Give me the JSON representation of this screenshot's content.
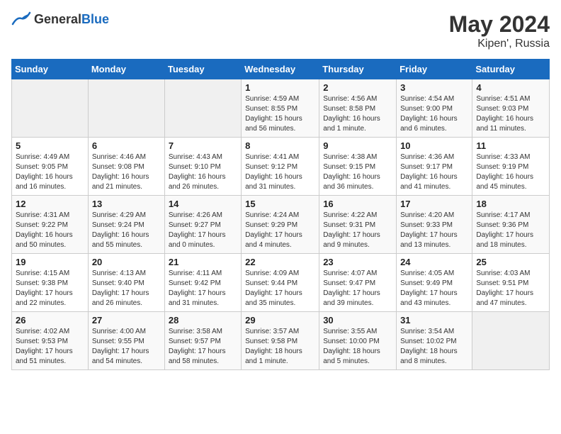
{
  "logo": {
    "general": "General",
    "blue": "Blue"
  },
  "title": {
    "month_year": "May 2024",
    "location": "Kipen', Russia"
  },
  "headers": [
    "Sunday",
    "Monday",
    "Tuesday",
    "Wednesday",
    "Thursday",
    "Friday",
    "Saturday"
  ],
  "weeks": [
    [
      {
        "day": "",
        "info": ""
      },
      {
        "day": "",
        "info": ""
      },
      {
        "day": "",
        "info": ""
      },
      {
        "day": "1",
        "info": "Sunrise: 4:59 AM\nSunset: 8:55 PM\nDaylight: 15 hours\nand 56 minutes."
      },
      {
        "day": "2",
        "info": "Sunrise: 4:56 AM\nSunset: 8:58 PM\nDaylight: 16 hours\nand 1 minute."
      },
      {
        "day": "3",
        "info": "Sunrise: 4:54 AM\nSunset: 9:00 PM\nDaylight: 16 hours\nand 6 minutes."
      },
      {
        "day": "4",
        "info": "Sunrise: 4:51 AM\nSunset: 9:03 PM\nDaylight: 16 hours\nand 11 minutes."
      }
    ],
    [
      {
        "day": "5",
        "info": "Sunrise: 4:49 AM\nSunset: 9:05 PM\nDaylight: 16 hours\nand 16 minutes."
      },
      {
        "day": "6",
        "info": "Sunrise: 4:46 AM\nSunset: 9:08 PM\nDaylight: 16 hours\nand 21 minutes."
      },
      {
        "day": "7",
        "info": "Sunrise: 4:43 AM\nSunset: 9:10 PM\nDaylight: 16 hours\nand 26 minutes."
      },
      {
        "day": "8",
        "info": "Sunrise: 4:41 AM\nSunset: 9:12 PM\nDaylight: 16 hours\nand 31 minutes."
      },
      {
        "day": "9",
        "info": "Sunrise: 4:38 AM\nSunset: 9:15 PM\nDaylight: 16 hours\nand 36 minutes."
      },
      {
        "day": "10",
        "info": "Sunrise: 4:36 AM\nSunset: 9:17 PM\nDaylight: 16 hours\nand 41 minutes."
      },
      {
        "day": "11",
        "info": "Sunrise: 4:33 AM\nSunset: 9:19 PM\nDaylight: 16 hours\nand 45 minutes."
      }
    ],
    [
      {
        "day": "12",
        "info": "Sunrise: 4:31 AM\nSunset: 9:22 PM\nDaylight: 16 hours\nand 50 minutes."
      },
      {
        "day": "13",
        "info": "Sunrise: 4:29 AM\nSunset: 9:24 PM\nDaylight: 16 hours\nand 55 minutes."
      },
      {
        "day": "14",
        "info": "Sunrise: 4:26 AM\nSunset: 9:27 PM\nDaylight: 17 hours\nand 0 minutes."
      },
      {
        "day": "15",
        "info": "Sunrise: 4:24 AM\nSunset: 9:29 PM\nDaylight: 17 hours\nand 4 minutes."
      },
      {
        "day": "16",
        "info": "Sunrise: 4:22 AM\nSunset: 9:31 PM\nDaylight: 17 hours\nand 9 minutes."
      },
      {
        "day": "17",
        "info": "Sunrise: 4:20 AM\nSunset: 9:33 PM\nDaylight: 17 hours\nand 13 minutes."
      },
      {
        "day": "18",
        "info": "Sunrise: 4:17 AM\nSunset: 9:36 PM\nDaylight: 17 hours\nand 18 minutes."
      }
    ],
    [
      {
        "day": "19",
        "info": "Sunrise: 4:15 AM\nSunset: 9:38 PM\nDaylight: 17 hours\nand 22 minutes."
      },
      {
        "day": "20",
        "info": "Sunrise: 4:13 AM\nSunset: 9:40 PM\nDaylight: 17 hours\nand 26 minutes."
      },
      {
        "day": "21",
        "info": "Sunrise: 4:11 AM\nSunset: 9:42 PM\nDaylight: 17 hours\nand 31 minutes."
      },
      {
        "day": "22",
        "info": "Sunrise: 4:09 AM\nSunset: 9:44 PM\nDaylight: 17 hours\nand 35 minutes."
      },
      {
        "day": "23",
        "info": "Sunrise: 4:07 AM\nSunset: 9:47 PM\nDaylight: 17 hours\nand 39 minutes."
      },
      {
        "day": "24",
        "info": "Sunrise: 4:05 AM\nSunset: 9:49 PM\nDaylight: 17 hours\nand 43 minutes."
      },
      {
        "day": "25",
        "info": "Sunrise: 4:03 AM\nSunset: 9:51 PM\nDaylight: 17 hours\nand 47 minutes."
      }
    ],
    [
      {
        "day": "26",
        "info": "Sunrise: 4:02 AM\nSunset: 9:53 PM\nDaylight: 17 hours\nand 51 minutes."
      },
      {
        "day": "27",
        "info": "Sunrise: 4:00 AM\nSunset: 9:55 PM\nDaylight: 17 hours\nand 54 minutes."
      },
      {
        "day": "28",
        "info": "Sunrise: 3:58 AM\nSunset: 9:57 PM\nDaylight: 17 hours\nand 58 minutes."
      },
      {
        "day": "29",
        "info": "Sunrise: 3:57 AM\nSunset: 9:58 PM\nDaylight: 18 hours\nand 1 minute."
      },
      {
        "day": "30",
        "info": "Sunrise: 3:55 AM\nSunset: 10:00 PM\nDaylight: 18 hours\nand 5 minutes."
      },
      {
        "day": "31",
        "info": "Sunrise: 3:54 AM\nSunset: 10:02 PM\nDaylight: 18 hours\nand 8 minutes."
      },
      {
        "day": "",
        "info": ""
      }
    ]
  ]
}
